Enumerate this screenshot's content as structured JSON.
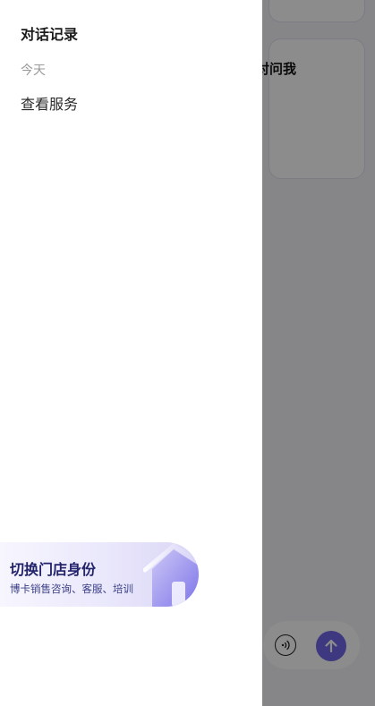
{
  "background": {
    "card_text": "对问我"
  },
  "drawer": {
    "title": "对话记录",
    "sections": [
      {
        "label": "今天",
        "items": [
          "查看服务"
        ]
      }
    ],
    "banner": {
      "title": "切换门店身份",
      "subtitle": "博卡销售咨询、客服、培训"
    }
  },
  "colors": {
    "accent": "#6f67e8",
    "banner_title": "#23236b",
    "scrim": "rgba(0,0,0,0.45)"
  },
  "icons": [
    "voice-icon",
    "send-arrow-icon",
    "house-icon"
  ]
}
